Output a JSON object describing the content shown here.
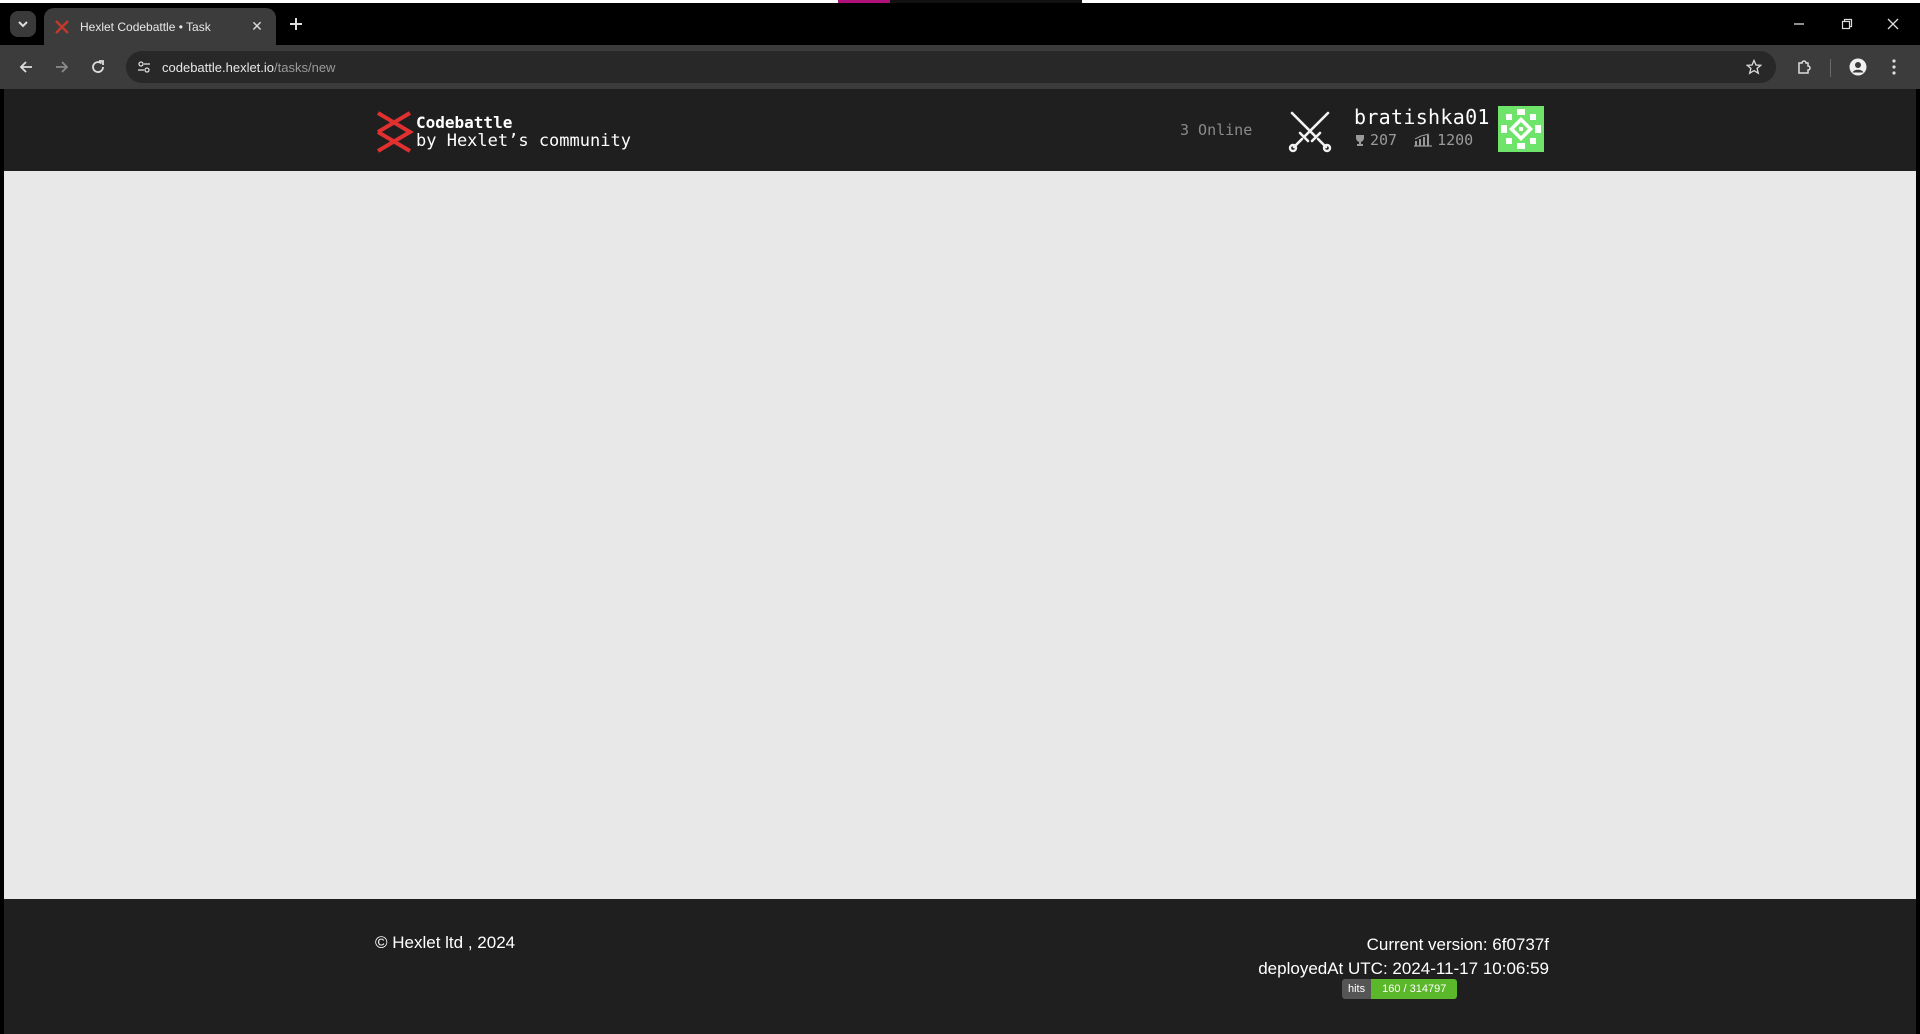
{
  "browser": {
    "tab_title": "Hexlet Codebattle • Task",
    "url_domain": "codebattle.hexlet.io",
    "url_path": "/tasks/new"
  },
  "header": {
    "brand_title": "Codebattle",
    "brand_subtitle": "by Hexlet’s community",
    "online": "3 Online",
    "username": "bratishka01",
    "trophies": "207",
    "rating": "1200"
  },
  "footer": {
    "copyright": "© Hexlet ltd , 2024",
    "version": "Current version: 6f0737f",
    "deployed": "deployedAt UTC: 2024-11-17 10:06:59",
    "hits_label": "hits",
    "hits_value": "160 / 314797"
  },
  "colors": {
    "accent_red": "#e03030",
    "header_bg": "#1f1f1f",
    "content_bg": "#e8e8e8",
    "hits_green": "#5cb82b"
  }
}
